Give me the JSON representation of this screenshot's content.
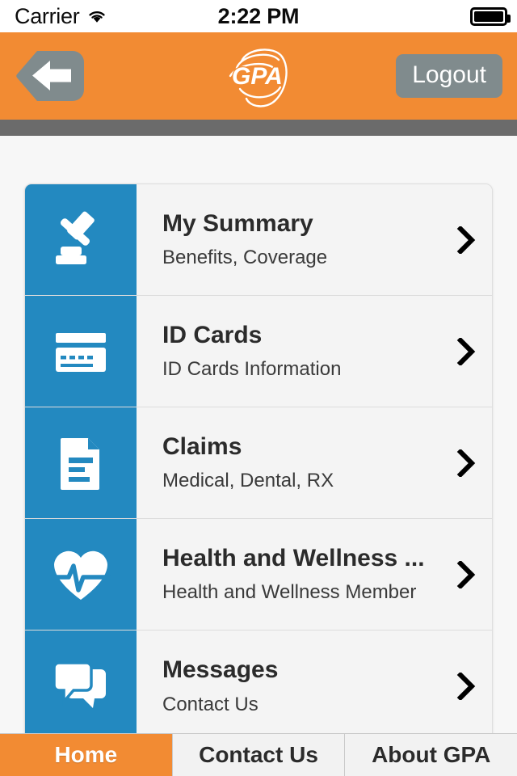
{
  "status_bar": {
    "carrier": "Carrier",
    "wifi_icon": "wifi-icon",
    "time": "2:22 PM",
    "battery_icon": "battery-full-icon"
  },
  "header": {
    "back_icon": "back-arrow-icon",
    "logo_text": "GPA",
    "logo_name": "gpa-logo",
    "logout_label": "Logout",
    "background_color": "#f28b33",
    "button_color": "#808b8d",
    "strip_color": "#6b6b6b"
  },
  "menu": {
    "accent_color": "#2389c0",
    "items": [
      {
        "title": "My Summary",
        "subtitle": "Benefits, Coverage",
        "icon": "gavel-icon",
        "chevron": "chevron-right-icon"
      },
      {
        "title": "ID Cards",
        "subtitle": "ID Cards Information",
        "icon": "credit-card-icon",
        "chevron": "chevron-right-icon"
      },
      {
        "title": "Claims",
        "subtitle": "Medical, Dental, RX",
        "icon": "document-icon",
        "chevron": "chevron-right-icon"
      },
      {
        "title": "Health and Wellness ...",
        "subtitle": "Health and Wellness Member",
        "icon": "heart-pulse-icon",
        "chevron": "chevron-right-icon"
      },
      {
        "title": "Messages",
        "subtitle": "Contact Us",
        "icon": "chat-bubbles-icon",
        "chevron": "chevron-right-icon"
      }
    ]
  },
  "tabbar": {
    "active_color": "#f28b33",
    "tabs": [
      {
        "label": "Home",
        "active": true
      },
      {
        "label": "Contact Us",
        "active": false
      },
      {
        "label": "About GPA",
        "active": false
      }
    ]
  }
}
